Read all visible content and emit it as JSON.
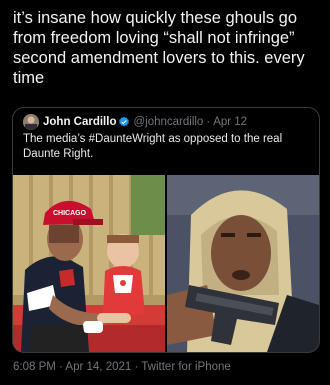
{
  "tweet": {
    "text": "it’s insane how quickly these ghouls go from freedom loving “shall not infringe” second amendment lovers to this. every time"
  },
  "quoted_tweet": {
    "author_name": "John Cardillo",
    "handle": "@johncardillo",
    "separator": "·",
    "date": "Apr 12",
    "text": "The media’s #DaunteWright as opposed to the real Daunte Right.",
    "cap_text": "CHICAGO"
  },
  "footer": {
    "time": "6:08 PM",
    "separator": " · ",
    "date": "Apr 14, 2021",
    "source": "Twitter for iPhone"
  },
  "colors": {
    "background": "#000000",
    "muted": "#71767b",
    "verified": "#1d9bf0"
  }
}
